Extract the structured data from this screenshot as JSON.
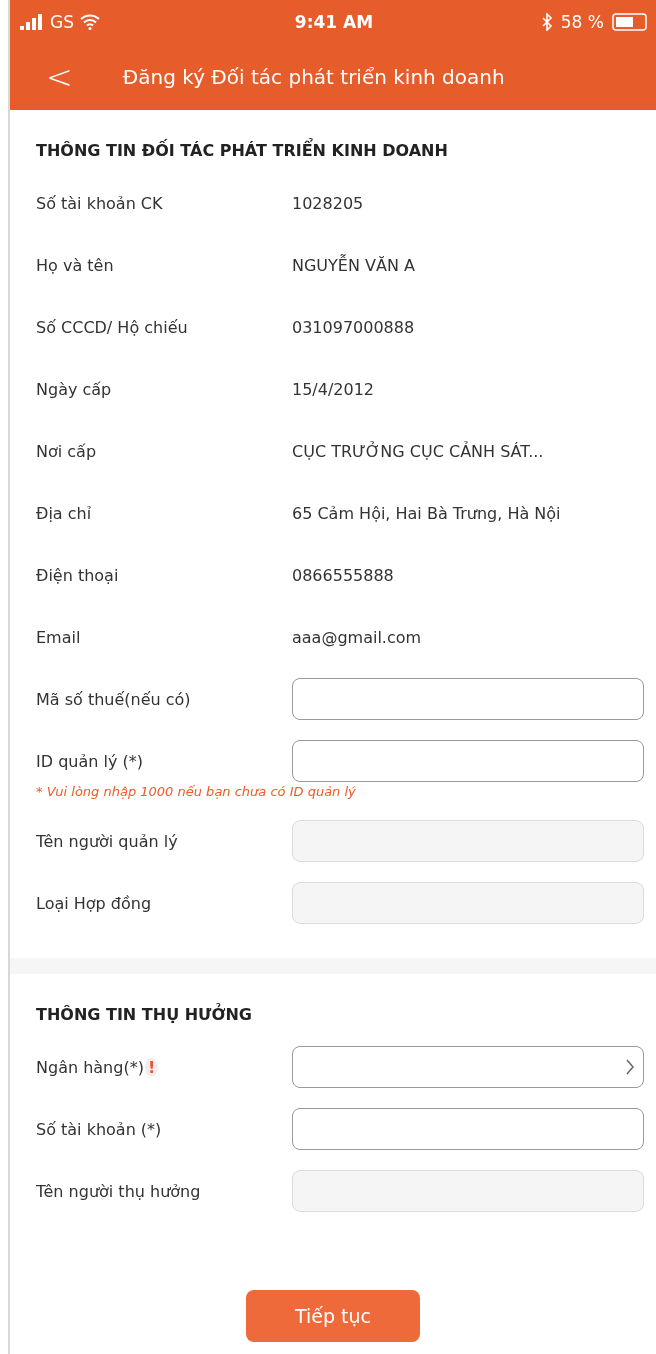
{
  "status_bar": {
    "carrier": "GS",
    "time": "9:41 AM",
    "battery": "58 %"
  },
  "header": {
    "back": "<",
    "title": "Đăng ký Đối tác phát triển kinh doanh"
  },
  "sections": [
    {
      "title": "THÔNG TIN ĐỐI TÁC PHÁT TRIỂN KINH DOANH",
      "rows": [
        {
          "kind": "static",
          "label": "Số tài khoản CK",
          "value": "1028205"
        },
        {
          "kind": "static",
          "label": "Họ và tên",
          "value": "NGUYỄN VĂN A"
        },
        {
          "kind": "static",
          "label": "Số CCCD/ Hộ chiếu",
          "value": "031097000888"
        },
        {
          "kind": "static",
          "label": "Ngày cấp",
          "value": "15/4/2012"
        },
        {
          "kind": "static",
          "label": "Nơi cấp",
          "value": "CỤC TRƯỞNG CỤC CẢNH SÁT..."
        },
        {
          "kind": "static",
          "label": "Địa chỉ",
          "value": "65 Cảm Hội, Hai Bà Trưng, Hà Nội"
        },
        {
          "kind": "static",
          "label": "Điện thoại",
          "value": "0866555888"
        },
        {
          "kind": "static",
          "label": "Email",
          "value": "aaa@gmail.com"
        },
        {
          "kind": "input",
          "label": "Mã số thuế(nếu có)"
        },
        {
          "kind": "input",
          "label": "ID quản lý (*)",
          "note": "* Vui lòng nhập 1000 nếu bạn chưa có ID quản lý"
        },
        {
          "kind": "readonly",
          "label": "Tên người quản lý"
        },
        {
          "kind": "readonly",
          "label": "Loại Hợp đồng"
        }
      ]
    },
    {
      "title": "THÔNG TIN THỤ HƯỞNG",
      "rows": [
        {
          "kind": "select",
          "label": "Ngân hàng(*)",
          "marker": "!"
        },
        {
          "kind": "input",
          "label": "Số tài khoản (*)"
        },
        {
          "kind": "readonly",
          "label": "Tên người thụ hưởng"
        }
      ]
    }
  ],
  "button": "Tiếp tục"
}
